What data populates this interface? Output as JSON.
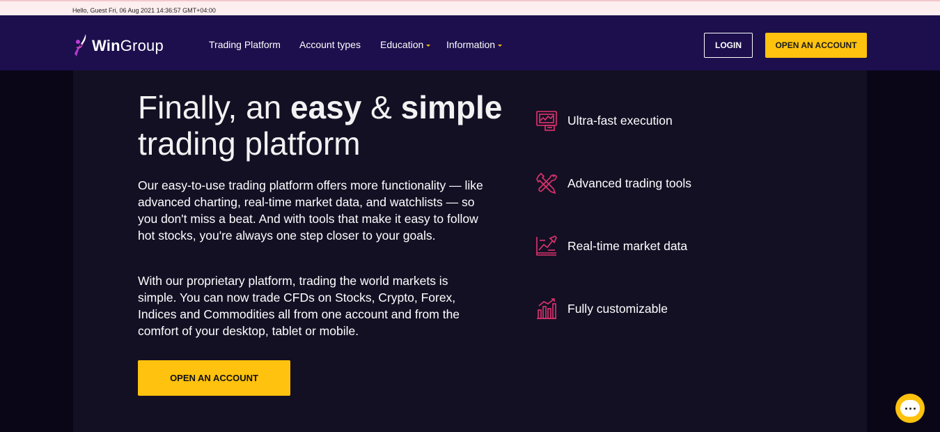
{
  "topbar": {
    "greeting": "Hello, Guest   Fri, 06 Aug 2021 14:36:57 GMT+04:00"
  },
  "header": {
    "logo_text_bold": "Win",
    "logo_text_rest": "Group",
    "nav": [
      {
        "label": "Trading Platform",
        "has_dropdown": false
      },
      {
        "label": "Account types",
        "has_dropdown": false
      },
      {
        "label": "Education",
        "has_dropdown": true
      },
      {
        "label": "Information",
        "has_dropdown": true
      }
    ],
    "login_label": "LOGIN",
    "open_account_label": "OPEN AN ACCOUNT"
  },
  "hero": {
    "title_part1": "Finally, an ",
    "title_bold1": "easy",
    "title_part2": " & ",
    "title_bold2": "simple",
    "title_line2": "trading platform",
    "paragraph1": "Our easy-to-use trading platform offers more functionality — like advanced charting, real-time market data, and watchlists — so you don't miss a beat. And with tools that make it easy to follow hot stocks, you're always one step closer to your goals.",
    "paragraph2": "With our proprietary platform, trading the world markets is simple. You can now trade CFDs on Stocks, Crypto, Forex, Indices and Commodities all from one account and from the comfort of your desktop, tablet or mobile.",
    "cta_label": "OPEN AN ACCOUNT"
  },
  "features": [
    {
      "label": "Ultra-fast execution",
      "icon": "monitor-chart-icon"
    },
    {
      "label": "Advanced trading tools",
      "icon": "wrench-screwdriver-icon"
    },
    {
      "label": "Real-time market data",
      "icon": "chart-pencil-icon"
    },
    {
      "label": "Fully customizable",
      "icon": "bar-chart-growth-icon"
    }
  ],
  "colors": {
    "header_bg": "#1d0f4d",
    "accent_yellow": "#ffc20e",
    "icon_pink": "#e0336f",
    "main_bg": "#141024"
  },
  "chat": {
    "icon": "chat-bubble-icon"
  }
}
